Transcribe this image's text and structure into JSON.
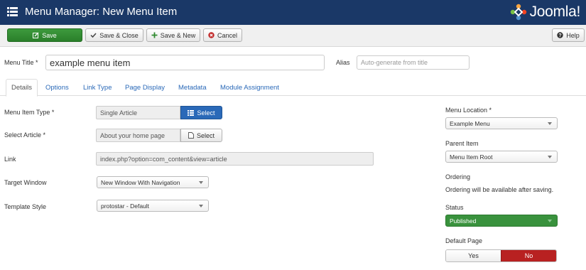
{
  "header": {
    "title": "Menu Manager: New Menu Item",
    "logo_text": "Joomla!"
  },
  "toolbar": {
    "save": "Save",
    "save_close": "Save & Close",
    "save_new": "Save & New",
    "cancel": "Cancel",
    "help": "Help"
  },
  "menu_title": {
    "label": "Menu Title *",
    "value": "example menu item"
  },
  "alias": {
    "label": "Alias",
    "placeholder": "Auto-generate from title"
  },
  "tabs": [
    "Details",
    "Options",
    "Link Type",
    "Page Display",
    "Metadata",
    "Module Assignment"
  ],
  "details": {
    "item_type": {
      "label": "Menu Item Type *",
      "value": "Single Article",
      "button": "Select"
    },
    "article": {
      "label": "Select Article *",
      "value": "About your home page",
      "button": "Select"
    },
    "link": {
      "label": "Link",
      "value": "index.php?option=com_content&view=article"
    },
    "target_window": {
      "label": "Target Window",
      "value": "New Window With Navigation"
    },
    "template_style": {
      "label": "Template Style",
      "value": "protostar - Default"
    }
  },
  "sidebar": {
    "menu_location": {
      "label": "Menu Location *",
      "value": "Example Menu"
    },
    "parent_item": {
      "label": "Parent Item",
      "value": "Menu Item Root"
    },
    "ordering": {
      "label": "Ordering",
      "text": "Ordering will be available after saving."
    },
    "status": {
      "label": "Status",
      "value": "Published"
    },
    "default_page": {
      "label": "Default Page",
      "yes": "Yes",
      "no": "No"
    }
  },
  "colors": {
    "header_bg": "#1a3867",
    "success": "#2f8a2f",
    "primary": "#2a69b8",
    "danger": "#b82121"
  },
  "icons": {
    "menu": "list-icon",
    "save": "edit-icon",
    "save_close": "check-icon",
    "save_new": "plus-icon",
    "cancel": "cancel-circle-icon",
    "help": "question-icon",
    "select_type": "list-icon",
    "select_article": "file-icon"
  }
}
